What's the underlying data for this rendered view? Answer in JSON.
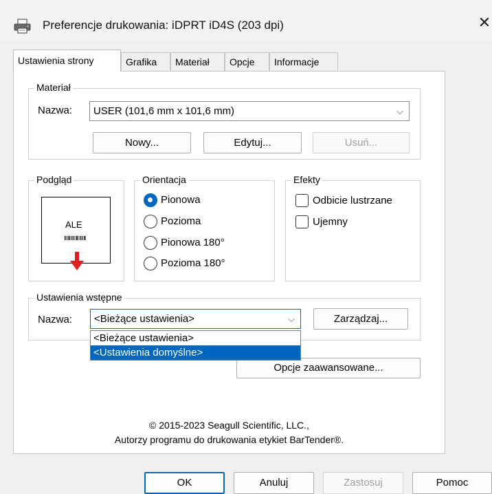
{
  "window": {
    "title": "Preferencje drukowania: iDPRT iD4S (203 dpi)",
    "close_symbol": "✕"
  },
  "tabs": [
    {
      "label": "Ustawienia strony",
      "active": true
    },
    {
      "label": "Grafika",
      "active": false
    },
    {
      "label": "Materiał",
      "active": false
    },
    {
      "label": "Opcje",
      "active": false
    },
    {
      "label": "Informacje",
      "active": false
    }
  ],
  "material": {
    "group_label": "Materiał",
    "name_label": "Nazwa:",
    "name_value": "USER (101,6 mm x 101,6 mm)",
    "new_button": "Nowy...",
    "edit_button": "Edytuj...",
    "delete_button": "Usuń..."
  },
  "preview": {
    "group_label": "Podgląd",
    "sample_text": "ALE",
    "arrow_color": "#e02020"
  },
  "orientation": {
    "group_label": "Orientacja",
    "options": [
      {
        "label": "Pionowa",
        "checked": true
      },
      {
        "label": "Pozioma",
        "checked": false
      },
      {
        "label": "Pionowa 180°",
        "checked": false
      },
      {
        "label": "Pozioma 180°",
        "checked": false
      }
    ]
  },
  "effects": {
    "group_label": "Efekty",
    "options": [
      {
        "label": "Odbicie lustrzane",
        "checked": false
      },
      {
        "label": "Ujemny",
        "checked": false
      }
    ]
  },
  "presets": {
    "group_label": "Ustawienia wstępne",
    "name_label": "Nazwa:",
    "name_value": "<Bieżące ustawienia>",
    "manage_button": "Zarządzaj...",
    "dropdown_options": [
      {
        "label": "<Bieżące ustawienia>",
        "selected": false
      },
      {
        "label": "<Ustawienia domyślne>",
        "selected": true
      }
    ]
  },
  "advanced_button": "Opcje zaawansowane...",
  "copyright": {
    "line1": "© 2015-2023 Seagull Scientific, LLC.,",
    "line2": "Autorzy programu do drukowania etykiet BarTender®."
  },
  "footer": {
    "ok": "OK",
    "cancel": "Anuluj",
    "apply": "Zastosuj",
    "help": "Pomoc"
  },
  "colors": {
    "accent": "#0067c0",
    "dialog_bg": "#f0f0f0",
    "panel_bg": "#ffffff"
  }
}
